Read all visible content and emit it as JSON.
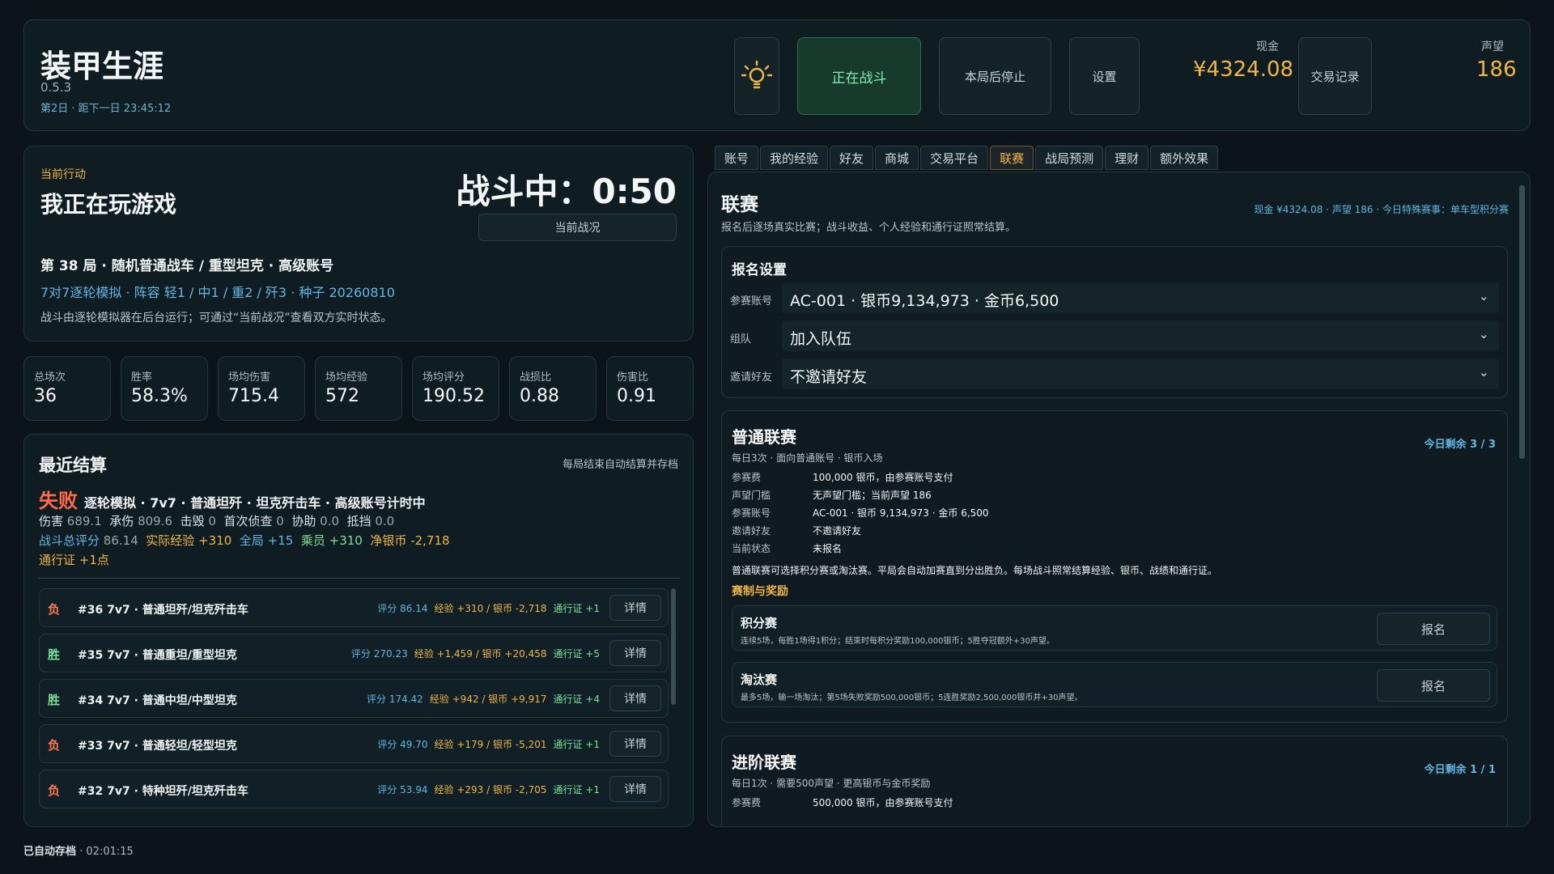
{
  "header": {
    "title": "装甲生涯",
    "version": "0.5.3",
    "day_line": "第2日 · 距下一日 23:45:12",
    "bulb_icon": "lightbulb-icon",
    "btn_fighting": "正在战斗",
    "btn_stop": "本局后停止",
    "btn_settings": "设置",
    "cash_label": "现金",
    "cash_value": "¥4324.08",
    "btn_trades": "交易记录",
    "rep_label": "声望",
    "rep_value": "186"
  },
  "current": {
    "label": "当前行动",
    "title": "我正在玩游戏",
    "timer": "战斗中：0:50",
    "status_btn": "当前战况",
    "round_line": "第 38 局 · 随机普通战车 / 重型坦克 · 高级账号",
    "mode_line": "7对7逐轮模拟 · 阵容 轻1 / 中1 / 重2 / 歼3 · 种子 20260810",
    "note_line": "战斗由逐轮模拟器在后台运行；可通过“当前战况”查看双方实时状态。"
  },
  "stats": [
    {
      "label": "总场次",
      "value": "36"
    },
    {
      "label": "胜率",
      "value": "58.3%"
    },
    {
      "label": "场均伤害",
      "value": "715.4"
    },
    {
      "label": "场均经验",
      "value": "572"
    },
    {
      "label": "场均评分",
      "value": "190.52"
    },
    {
      "label": "战损比",
      "value": "0.88"
    },
    {
      "label": "伤害比",
      "value": "0.91"
    }
  ],
  "recent": {
    "title": "最近结算",
    "note": "每局结束自动结算并存档",
    "result": "失败",
    "result_desc": "逐轮模拟 · 7v7 · 普通坦歼 · 坦克歼击车 · 高级账号计时中",
    "line2": [
      {
        "k": "伤害",
        "v": "689.1"
      },
      {
        "k": "承伤",
        "v": "809.6"
      },
      {
        "k": "击毁",
        "v": "0"
      },
      {
        "k": "首次侦查",
        "v": "0"
      },
      {
        "k": "协助",
        "v": "0.0"
      },
      {
        "k": "抵挡",
        "v": "0.0"
      }
    ],
    "score_label": "战斗总评分",
    "score_value": "86.14",
    "xp_label": "实际经验",
    "xp_value": "+310",
    "global_label": "全局",
    "global_value": "+15",
    "crew_label": "乘员",
    "crew_value": "+310",
    "silver_label": "净银币",
    "silver_value": "-2,718",
    "pass_label": "通行证",
    "pass_value": "+1点",
    "detail_label": "详情",
    "matches": [
      {
        "res": "负",
        "win": false,
        "name": "#36 7v7 · 普通坦歼/坦克歼击车",
        "score": "评分 86.14",
        "econ": "经验 +310 / 银币 -2,718",
        "pass": "通行证 +1"
      },
      {
        "res": "胜",
        "win": true,
        "name": "#35 7v7 · 普通重坦/重型坦克",
        "score": "评分 270.23",
        "econ": "经验 +1,459 / 银币 +20,458",
        "pass": "通行证 +5"
      },
      {
        "res": "胜",
        "win": true,
        "name": "#34 7v7 · 普通中坦/中型坦克",
        "score": "评分 174.42",
        "econ": "经验 +942 / 银币 +9,917",
        "pass": "通行证 +4"
      },
      {
        "res": "负",
        "win": false,
        "name": "#33 7v7 · 普通轻坦/轻型坦克",
        "score": "评分 49.70",
        "econ": "经验 +179 / 银币 -5,201",
        "pass": "通行证 +1"
      },
      {
        "res": "负",
        "win": false,
        "name": "#32 7v7 · 特种坦歼/坦克歼击车",
        "score": "评分 53.94",
        "econ": "经验 +293 / 银币 -2,705",
        "pass": "通行证 +1"
      }
    ]
  },
  "autosave": {
    "label": "已自动存档",
    "time": "· 02:01:15"
  },
  "tabs": [
    "账号",
    "我的经验",
    "好友",
    "商城",
    "交易平台",
    "联赛",
    "战局预测",
    "理财",
    "额外效果"
  ],
  "active_tab": "联赛",
  "league": {
    "title": "联赛",
    "subtitle": "报名后逐场真实比赛；战斗收益、个人经验和通行证照常结算。",
    "status_line": "现金 ¥4324.08 · 声望 186 · 今日特殊赛事：单车型积分赛",
    "signup": {
      "title": "报名设置",
      "fields": [
        {
          "label": "参赛账号",
          "value": "AC-001 · 银币9,134,973 · 金币6,500"
        },
        {
          "label": "组队",
          "value": "加入队伍"
        },
        {
          "label": "邀请好友",
          "value": "不邀请好友"
        }
      ]
    },
    "normal": {
      "title": "普通联赛",
      "sub": "每日3次 · 面向普通账号 · 银币入场",
      "remain": "今日剩余 3 / 3",
      "rows": [
        {
          "k": "参赛费",
          "v": "100,000 银币，由参赛账号支付"
        },
        {
          "k": "声望门槛",
          "v": "无声望门槛；当前声望 186"
        },
        {
          "k": "参赛账号",
          "v": "AC-001 · 银币 9,134,973 · 金币 6,500"
        },
        {
          "k": "邀请好友",
          "v": "不邀请好友"
        },
        {
          "k": "当前状态",
          "v": "未报名"
        }
      ],
      "desc": "普通联赛可选择积分赛或淘汰赛。平局会自动加赛直到分出胜负。每场战斗照常结算经验、银币、战绩和通行证。",
      "section": "赛制与奖励",
      "formats": [
        {
          "title": "积分赛",
          "desc": "连续5场，每胜1场得1积分；结束时每积分奖励100,000银币；5胜夺冠额外+30声望。",
          "btn": "报名"
        },
        {
          "title": "淘汰赛",
          "desc": "最多5场，输一场淘汰；第5场失败奖励500,000银币；5连胜奖励2,500,000银币并+30声望。",
          "btn": "报名"
        }
      ]
    },
    "advanced": {
      "title": "进阶联赛",
      "sub": "每日1次 · 需要500声望 · 更高银币与金币奖励",
      "remain": "今日剩余 1 / 1",
      "rows": [
        {
          "k": "参赛费",
          "v": "500,000 银币，由参赛账号支付"
        }
      ]
    }
  }
}
